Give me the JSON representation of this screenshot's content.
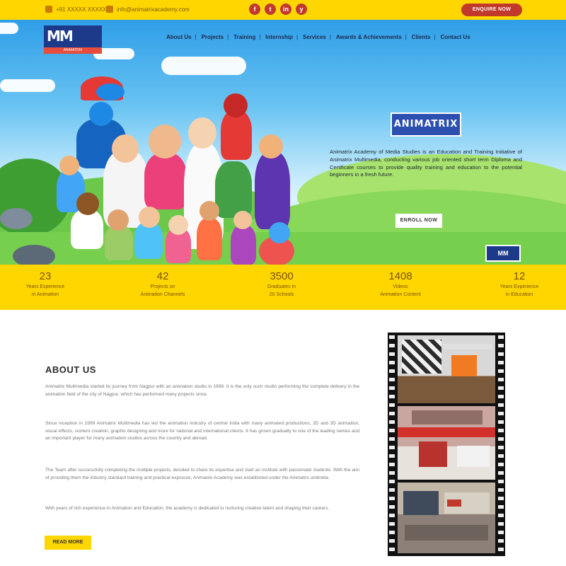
{
  "topbar": {
    "phone": "+91 XXXXX XXXXX",
    "email": "info@animatrixacademy.com",
    "social": [
      "f",
      "t",
      "in",
      "y"
    ],
    "cta_label": "ENQUIRE NOW"
  },
  "nav": {
    "items": [
      "About Us",
      "Projects",
      "Training",
      "Internship",
      "Services",
      "Awards & Achievements",
      "Clients",
      "Contact Us"
    ]
  },
  "logo": {
    "mark": "MM",
    "sub": "ANIMATRIX"
  },
  "hero": {
    "badge": "ANIMATRIX",
    "description": "Animatrix Academy of Media Studies is an Education and Training Initiative of Animatrix Multimedia, conducting various job oriented short term Diploma and Certificate courses to provide quality training and education to the potential beginners in a fresh future.",
    "button_label": "ENROLL NOW",
    "mini_logo": "MM"
  },
  "stats": [
    {
      "num": "23",
      "label_1": "Years Experience",
      "label_2": "in Animation"
    },
    {
      "num": "42",
      "label_1": "Projects on",
      "label_2": "Animation Channels"
    },
    {
      "num": "3500",
      "label_1": "Graduates in",
      "label_2": "20 Schools"
    },
    {
      "num": "1408",
      "label_1": "Videos",
      "label_2": "Animation Content"
    },
    {
      "num": "12",
      "label_1": "Years Experience",
      "label_2": "in Education"
    }
  ],
  "about": {
    "title": "ABOUT US",
    "paragraphs": [
      "Animatrix Multimedia started its journey from Nagpur with an animation studio in 1999. It is the only such studio performing the complete delivery in the animation field of the city of Nagpur, which has performed many projects since.",
      "Since inception in 1999 Animatrix Multimedia has led the animation industry of central India with many animated productions, 2D and 3D animation, visual effects, content creation, graphic designing and more for national and international clients. It has grown gradually to one of the leading names and an important player for many animation studios across the country and abroad.",
      "The Team after successfully completing the multiple projects, decided to share its expertise and start an institute with passionate students. With the aim of providing them the industry standard training and practical exposure, Animatrix Academy was established under the Animatrix umbrella.",
      "With years of rich experience in Animation and Education, the academy is dedicated to nurturing creative talent and shaping their careers."
    ],
    "read_more": "READ MORE"
  },
  "colors": {
    "accent_yellow": "#ffd600",
    "accent_red": "#c0392b",
    "brand_blue": "#1d3a8a"
  },
  "icons": {
    "phone": "phone-icon",
    "email": "email-icon"
  }
}
